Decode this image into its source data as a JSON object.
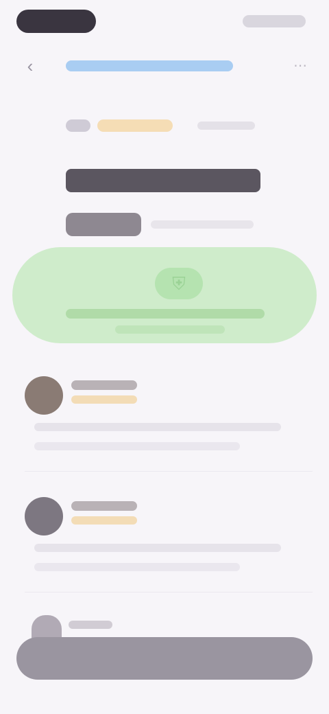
{
  "status_bar": {
    "time": "",
    "indicators": ""
  },
  "browser": {
    "back_icon": "chevron-left-icon",
    "url": "",
    "menu_icon": "more-icon"
  },
  "article": {
    "category": "",
    "badge": "",
    "time": "",
    "headline": "",
    "author": "",
    "byline": ""
  },
  "feature": {
    "icon": "shield-icon",
    "caption": "",
    "subcaption": ""
  },
  "comments": [
    {
      "name": "",
      "role": "",
      "line1": "",
      "line2": ""
    },
    {
      "name": "",
      "role": "",
      "line1": "",
      "line2": ""
    }
  ],
  "footer": {
    "name": "",
    "action_label": ""
  },
  "colors": {
    "accent_blue": "#a9cdf2",
    "accent_green": "#cfeccb",
    "badge_orange": "#f5ddb5",
    "button": "#9a95a0"
  }
}
